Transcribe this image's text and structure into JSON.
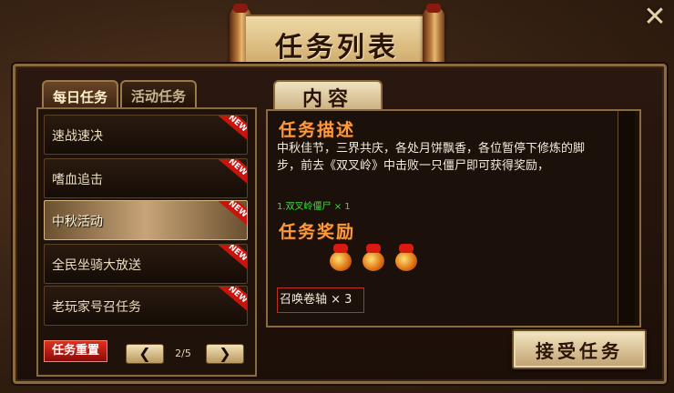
{
  "window": {
    "title": "任务列表",
    "close_label": "✕"
  },
  "tabs": [
    {
      "label": "每日任务",
      "active": true
    },
    {
      "label": "活动任务",
      "active": false
    }
  ],
  "quests": [
    {
      "label": "速战速决",
      "badge": "NEW",
      "selected": false
    },
    {
      "label": "嗜血追击",
      "badge": "NEW",
      "selected": false
    },
    {
      "label": "中秋活动",
      "badge": "NEW",
      "selected": true
    },
    {
      "label": "全民坐骑大放送",
      "badge": "NEW",
      "selected": false
    },
    {
      "label": "老玩家号召任务",
      "badge": "NEW",
      "selected": false
    }
  ],
  "footer": {
    "reset_label": "任务重置",
    "prev_label": "❮",
    "next_label": "❯",
    "page": "2/5"
  },
  "content": {
    "tab_label": "内容",
    "desc_title": "任务描述",
    "description": "中秋佳节，三界共庆，各处月饼飘香，各位暂停下修炼的脚步，前去《双叉岭》中击败一只僵尸即可获得奖励，",
    "objective": "1.双叉岭僵尸 × 1",
    "reward_title": "任务奖励",
    "reward_icons": [
      "gift-pouch-icon",
      "gift-pouch-icon",
      "gift-pouch-icon"
    ],
    "reward_item": "召唤卷轴 × 3",
    "accept_label": "接受任务"
  },
  "colors": {
    "accent_orange": "#ff9a3a",
    "badge_red": "#c8140c",
    "objective_green": "#3ae03a",
    "frame_gold": "#8a6a3e"
  }
}
